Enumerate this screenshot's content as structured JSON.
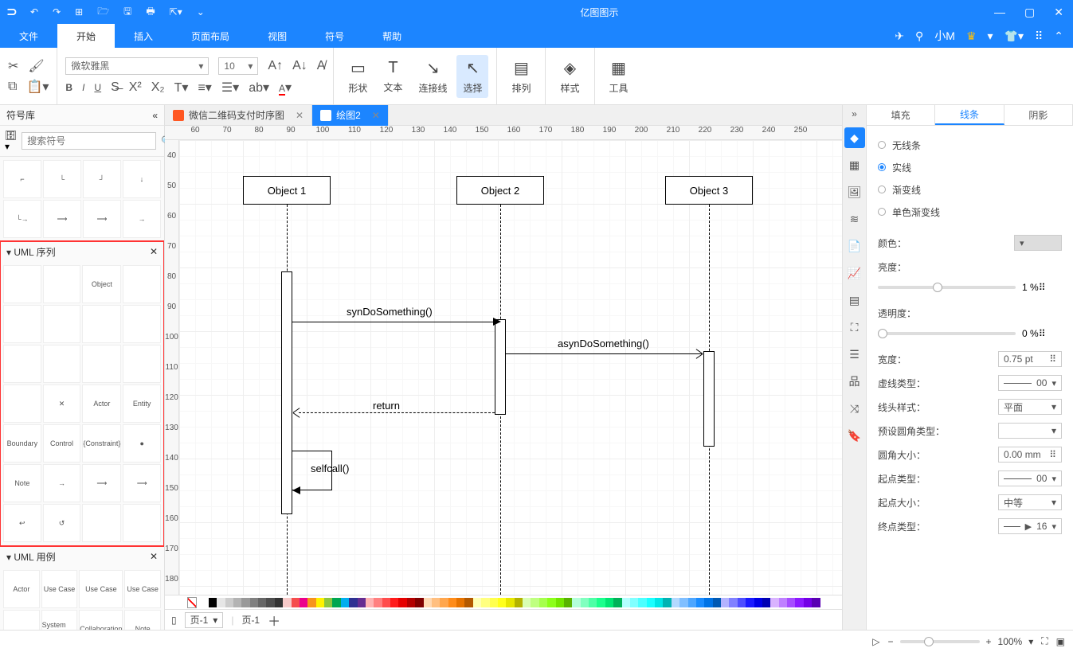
{
  "app": {
    "title": "亿图图示"
  },
  "menu": {
    "tabs": [
      "文件",
      "开始",
      "插入",
      "页面布局",
      "视图",
      "符号",
      "帮助"
    ],
    "active": 1,
    "user": "小M"
  },
  "ribbon": {
    "font": "微软雅黑",
    "size": "10",
    "big": [
      {
        "icon": "▭",
        "label": "形状"
      },
      {
        "icon": "T",
        "label": "文本"
      },
      {
        "icon": "↘",
        "label": "连接线"
      },
      {
        "icon": "↖",
        "label": "选择"
      },
      {
        "icon": "▤",
        "label": "排列"
      },
      {
        "icon": "◈",
        "label": "样式"
      },
      {
        "icon": "▦",
        "label": "工具"
      }
    ],
    "selected_big": 3
  },
  "left": {
    "title": "符号库",
    "search_ph": "搜索符号",
    "cats": [
      {
        "name": "UML 序列",
        "hl": true
      },
      {
        "name": "UML 用例",
        "hl": false
      }
    ],
    "uml_seq_items": [
      "",
      "",
      "Object",
      "",
      "",
      "",
      "",
      "",
      "",
      "",
      "",
      "",
      "",
      "✕",
      "Actor",
      "Entity",
      "Boundary",
      "Control",
      "{Constraint}",
      "●",
      "Note",
      "→",
      "⟶",
      "⟶",
      "↩",
      "↺",
      "",
      ""
    ],
    "uml_uc_items": [
      "Actor",
      "Use Case",
      "Use Case",
      "Use Case",
      "",
      "System Actor",
      "Collaboration",
      "Note"
    ]
  },
  "docs": {
    "tabs": [
      {
        "name": "微信二维码支付时序图",
        "active": false
      },
      {
        "name": "绘图2",
        "active": true
      }
    ]
  },
  "canvas": {
    "h_ticks": [
      "60",
      "70",
      "80",
      "90",
      "100",
      "110",
      "120",
      "130",
      "140",
      "150",
      "160",
      "170",
      "180",
      "190",
      "200",
      "210",
      "220",
      "230",
      "240",
      "250"
    ],
    "v_ticks": [
      "40",
      "50",
      "60",
      "70",
      "80",
      "90",
      "100",
      "110",
      "120",
      "130",
      "140",
      "150",
      "160",
      "170",
      "180"
    ],
    "objects": [
      "Object 1",
      "Object 2",
      "Object 3"
    ],
    "msgs": {
      "syn": "synDoSomething()",
      "asyn": "asynDoSomething()",
      "ret": "return",
      "self": "selfcall()"
    }
  },
  "right": {
    "tabs": [
      "填充",
      "线条",
      "阴影"
    ],
    "active": 1,
    "line_types": [
      "无线条",
      "实线",
      "渐变线",
      "单色渐变线"
    ],
    "line_sel": 1,
    "rows": {
      "color": "颜色：",
      "bright": "亮度：",
      "bright_v": "1 %",
      "opacity": "透明度：",
      "opacity_v": "0 %",
      "width": "宽度：",
      "width_v": "0.75 pt",
      "dash": "虚线类型：",
      "dash_v": "00",
      "cap": "线头样式：",
      "cap_v": "平面",
      "round": "预设圆角类型：",
      "rsize": "圆角大小：",
      "rsize_v": "0.00 mm",
      "start": "起点类型：",
      "start_v": "00",
      "ssize": "起点大小：",
      "ssize_v": "中等",
      "end": "终点类型：",
      "end_v": "16"
    }
  },
  "page": {
    "label": "页-1",
    "current": "页-1"
  },
  "status": {
    "zoom": "100%"
  },
  "colors": [
    "#fff",
    "#000",
    "#e6e6e6",
    "#ccc",
    "#b3b3b3",
    "#999",
    "#808080",
    "#666",
    "#4d4d4d",
    "#333",
    "#f7cac9",
    "#f54d4d",
    "#ec008c",
    "#f7941d",
    "#fff200",
    "#8dc63f",
    "#00a651",
    "#00aeef",
    "#2e3192",
    "#662d91",
    "#ffb3b3",
    "#ff8080",
    "#ff4d4d",
    "#ff1a1a",
    "#e60000",
    "#b30000",
    "#800000",
    "#ffd9b3",
    "#ffbf80",
    "#ffa64d",
    "#ff8c1a",
    "#e67300",
    "#b35900",
    "#ffffb3",
    "#ffff80",
    "#ffff4d",
    "#ffff1a",
    "#e6e600",
    "#b3b300",
    "#d9ffb3",
    "#bfff80",
    "#a6ff4d",
    "#8cff1a",
    "#73e600",
    "#59b300",
    "#b3ffd9",
    "#80ffbf",
    "#4dffa6",
    "#1aff8c",
    "#00e673",
    "#00b359",
    "#b3ffff",
    "#80ffff",
    "#4dffff",
    "#1affff",
    "#00e6e6",
    "#00b3b3",
    "#b3d9ff",
    "#80bfff",
    "#4da6ff",
    "#1a8cff",
    "#0073e6",
    "#0059b3",
    "#b3b3ff",
    "#8080ff",
    "#4d4dff",
    "#1a1aff",
    "#0000e6",
    "#0000b3",
    "#d9b3ff",
    "#bf80ff",
    "#a64dff",
    "#8c1aff",
    "#7300e6",
    "#5900b3"
  ]
}
